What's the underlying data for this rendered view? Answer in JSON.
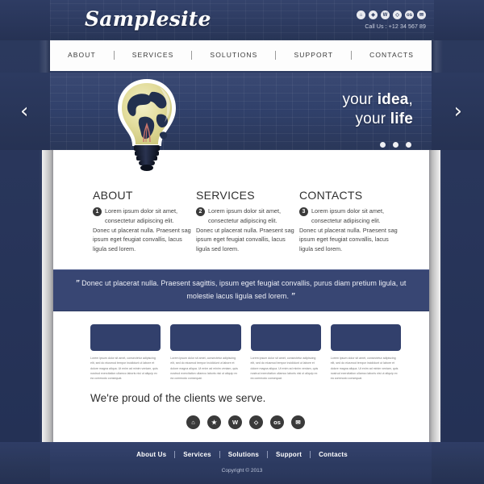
{
  "header": {
    "brand": "Samplesite",
    "call_us": "Call Us : +12 34 567 89",
    "social_icons": [
      {
        "name": "home-icon",
        "glyph": "⌂"
      },
      {
        "name": "compass-icon",
        "glyph": "◈"
      },
      {
        "name": "wordpress-icon",
        "glyph": "W"
      },
      {
        "name": "diamond-icon",
        "glyph": "◇"
      },
      {
        "name": "os-icon",
        "glyph": "os"
      },
      {
        "name": "envelope-icon",
        "glyph": "✉"
      }
    ]
  },
  "nav": {
    "items": [
      {
        "label": "ABOUT"
      },
      {
        "label": "SERVICES"
      },
      {
        "label": "SOLUTIONS"
      },
      {
        "label": "SUPPORT"
      },
      {
        "label": "CONTACTS"
      }
    ]
  },
  "hero": {
    "line1_plain": "your ",
    "line1_bold": "idea",
    "line1_tail": ",",
    "line2_plain": "your ",
    "line2_bold": "life",
    "prev_arrow": "‹",
    "next_arrow": "›",
    "dots_count": 3,
    "bulb_alt": "lightbulb-with-globe"
  },
  "columns": [
    {
      "title": "ABOUT",
      "number": "1",
      "body": "Lorem ipsum dolor sit amet, consectetur adipiscing elit. Donec ut placerat nulla. Praesent sag ipsum eget feugiat convallis, lacus ligula sed lorem."
    },
    {
      "title": "SERVICES",
      "number": "2",
      "body": "Lorem ipsum dolor sit amet, consectetur adipiscing elit. Donec ut placerat nulla. Praesent sag ipsum eget feugiat convallis, lacus ligula sed lorem."
    },
    {
      "title": "CONTACTS",
      "number": "3",
      "body": "Lorem ipsum dolor sit amet, consectetur adipiscing elit. Donec ut placerat nulla. Praesent sag ipsum eget feugiat convallis, lacus ligula sed lorem."
    }
  ],
  "quote": {
    "open_mark": "”",
    "text": "Donec ut placerat nulla. Praesent sagittis, ipsum eget feugiat convallis, purus diam pretium ligula, ut molestie lacus ligula sed lorem.",
    "close_mark": "”"
  },
  "thumbs": [
    {
      "caption": "Lorem ipsum dolor sit amet, consectetur adipiscing elit, sed do eiusmod tempor incididunt ut labore et dolore magna aliqua. Ut enim ad minim veniam, quis nostrud exercitation ullamco laboris nisi ut aliquip ex ea commodo consequat."
    },
    {
      "caption": "Lorem ipsum dolor sit amet, consectetur adipiscing elit, sed do eiusmod tempor incididunt ut labore et dolore magna aliqua. Ut enim ad minim veniam, quis nostrud exercitation ullamco laboris nisi ut aliquip ex ea commodo consequat."
    },
    {
      "caption": "Lorem ipsum dolor sit amet, consectetur adipiscing elit, sed do eiusmod tempor incididunt ut labore et dolore magna aliqua. Ut enim ad minim veniam, quis nostrud exercitation ullamco laboris nisi ut aliquip ex ea commodo consequat."
    },
    {
      "caption": "Lorem ipsum dolor sit amet, consectetur adipiscing elit, sed do eiusmod tempor incididunt ut labore et dolore magna aliqua. Ut enim ad minim veniam, quis nostrud exercitation ullamco laboris nisi ut aliquip ex ea commodo consequat."
    }
  ],
  "clients": {
    "heading": "We're proud of the clients we serve.",
    "logos": [
      {
        "name": "home-logo-icon",
        "glyph": "⌂"
      },
      {
        "name": "star-logo-icon",
        "glyph": "★"
      },
      {
        "name": "w-logo-icon",
        "glyph": "W"
      },
      {
        "name": "diamond-logo-icon",
        "glyph": "⬦"
      },
      {
        "name": "os-logo-icon",
        "glyph": "os"
      },
      {
        "name": "envelope-logo-icon",
        "glyph": "✉"
      }
    ]
  },
  "footer": {
    "items": [
      {
        "label": "About Us"
      },
      {
        "label": "Services"
      },
      {
        "label": "Solutions"
      },
      {
        "label": "Support"
      },
      {
        "label": "Contacts"
      }
    ],
    "copyright": "Copyright © 2013"
  },
  "colors": {
    "primary_dark": "#2b3a60",
    "hero_blue": "#30406a",
    "quote_band": "#384673",
    "thumb_box": "#32406c",
    "icon_dark": "#3a3a3a"
  }
}
